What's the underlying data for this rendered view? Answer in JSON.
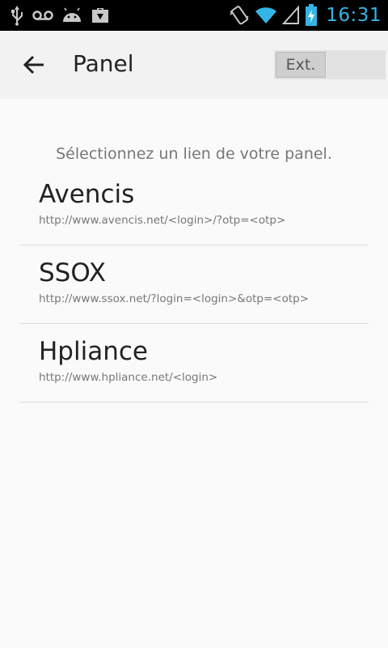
{
  "status_bar": {
    "time": "16:31",
    "icons": [
      "usb-icon",
      "voicemail-icon",
      "android-icon",
      "briefcase-icon",
      "vibrate-icon",
      "wifi-icon",
      "signal-icon",
      "battery-charging-icon"
    ]
  },
  "action_bar": {
    "title": "Panel",
    "toggle_label": "Ext."
  },
  "prompt": "Sélectionnez un lien de votre panel.",
  "links": [
    {
      "title": "Avencis",
      "url": "http://www.avencis.net/<login>/?otp=<otp>"
    },
    {
      "title": "SSOX",
      "url": "http://www.ssox.net/?login=<login>&otp=<otp>"
    },
    {
      "title": "Hpliance",
      "url": "http://www.hpliance.net/<login>"
    }
  ],
  "colors": {
    "accent": "#33b5e5",
    "background": "#fafafa",
    "action_bar": "#f2f2f2"
  }
}
